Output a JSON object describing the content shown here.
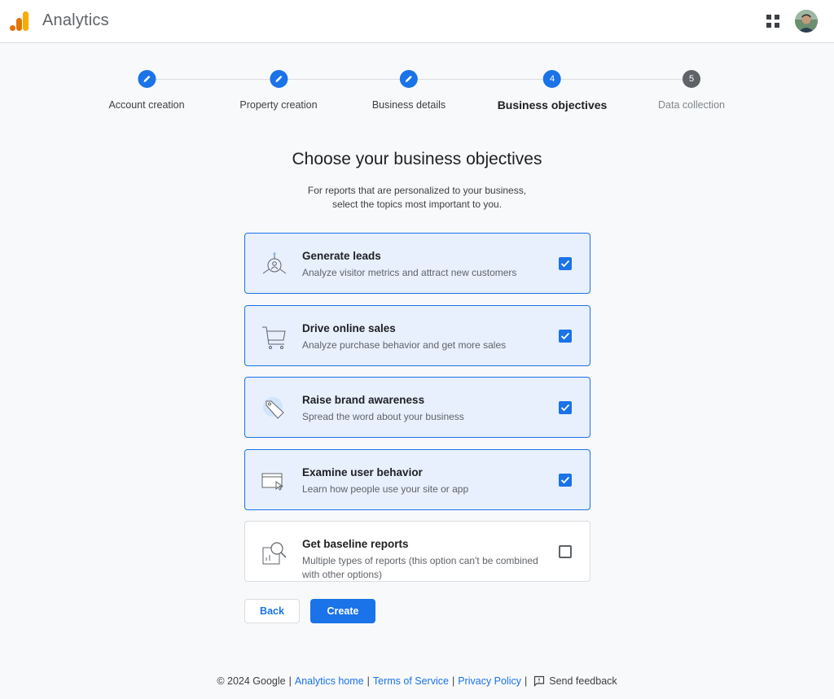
{
  "header": {
    "app_title": "Analytics",
    "logo_icon": "google-analytics-logo",
    "apps_icon": "apps-grid-icon",
    "avatar_icon": "user-avatar"
  },
  "stepper": {
    "steps": [
      {
        "label": "Account creation",
        "state": "done",
        "number": ""
      },
      {
        "label": "Property creation",
        "state": "done",
        "number": ""
      },
      {
        "label": "Business details",
        "state": "done",
        "number": ""
      },
      {
        "label": "Business objectives",
        "state": "active",
        "number": "4"
      },
      {
        "label": "Data collection",
        "state": "pending",
        "number": "5"
      }
    ]
  },
  "main": {
    "title": "Choose your business objectives",
    "subtitle_line1": "For reports that are personalized to your business,",
    "subtitle_line2": "select the topics most important to you."
  },
  "objectives": [
    {
      "title": "Generate leads",
      "description": "Analyze visitor metrics and attract new customers",
      "checked": true,
      "icon": "leads-target-icon"
    },
    {
      "title": "Drive online sales",
      "description": "Analyze purchase behavior and get more sales",
      "checked": true,
      "icon": "shopping-cart-icon"
    },
    {
      "title": "Raise brand awareness",
      "description": "Spread the word about your business",
      "checked": true,
      "icon": "tag-icon"
    },
    {
      "title": "Examine user behavior",
      "description": "Learn how people use your site or app",
      "checked": true,
      "icon": "browser-cursor-icon"
    },
    {
      "title": "Get baseline reports",
      "description": "Multiple types of reports (this option can't be combined with other options)",
      "checked": false,
      "icon": "report-magnifier-icon"
    }
  ],
  "actions": {
    "back_label": "Back",
    "create_label": "Create"
  },
  "footer": {
    "copyright": "© 2024 Google",
    "sep": "|",
    "analytics_home": "Analytics home",
    "terms": "Terms of Service",
    "privacy": "Privacy Policy",
    "feedback": "Send feedback"
  },
  "colors": {
    "accent": "#1a73e8",
    "selected_bg": "#e8f0fe",
    "pending_step": "#5f6368"
  }
}
